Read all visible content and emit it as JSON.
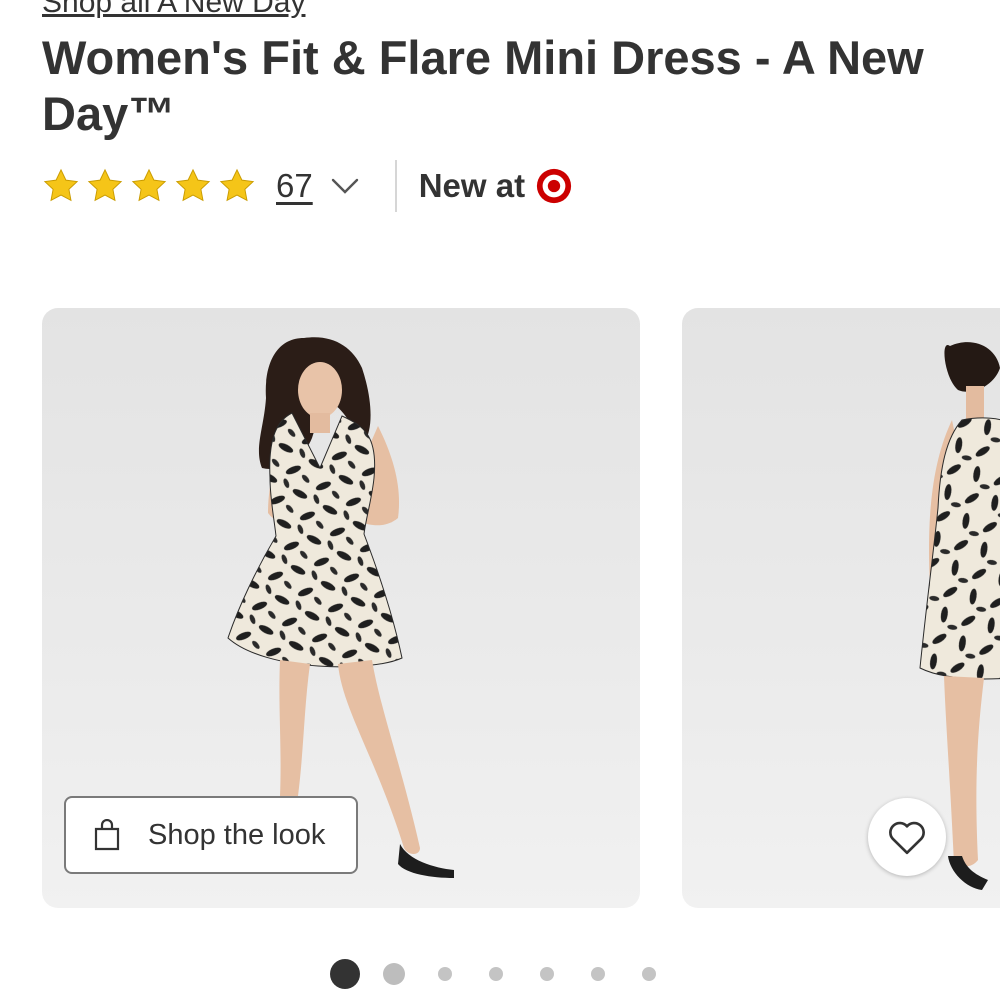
{
  "breadcrumb": {
    "brand_link": "Shop all A New Day"
  },
  "product": {
    "title": "Women's Fit & Flare Mini Dress - A New Day™"
  },
  "rating": {
    "stars": 5,
    "max_stars": 5,
    "review_count": "67",
    "star_color": "#f5c518"
  },
  "availability": {
    "new_at_label": "New at",
    "logo_icon": "target-bullseye-icon",
    "brand_color": "#cc0000"
  },
  "gallery": {
    "shop_the_look_label": "Shop the look",
    "favorite_icon": "heart-icon",
    "total_images": 7,
    "active_index": 0
  }
}
